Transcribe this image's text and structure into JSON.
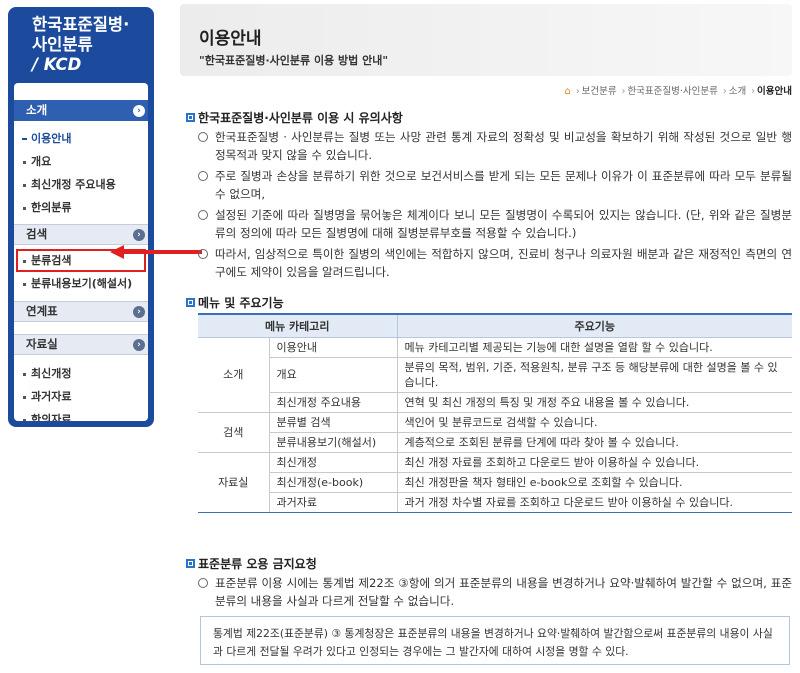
{
  "sidebar": {
    "brand_line1": "한국표준질병·",
    "brand_line2": "사인분류",
    "brand_line3": "/ KCD",
    "sections": [
      {
        "label": "소개",
        "items": [
          "이용안내",
          "개요",
          "최신개정 주요내용",
          "한의분류"
        ]
      },
      {
        "label": "검색",
        "items": [
          "분류검색",
          "분류내용보기(해설서)"
        ]
      },
      {
        "label": "연계표",
        "items": []
      },
      {
        "label": "자료실",
        "items": [
          "최신개정",
          "과거자료",
          "한의자료"
        ]
      }
    ]
  },
  "banner": {
    "title": "이용안내",
    "subtitle": "\"한국표준질병·사인분류 이용 방법 안내\""
  },
  "breadcrumb": [
    "보건분류",
    "한국표준질병·사인분류",
    "소개",
    "이용안내"
  ],
  "sections": {
    "caution_title": "한국표준질병·사인분류 이용 시 유의사항",
    "caution_items": [
      "한국표준질병 · 사인분류는 질병 또는 사망 관련 통계 자료의 정확성 및 비교성을 확보하기 위해 작성된 것으로 일반 행정목적과 맞지 않을 수 있습니다.",
      "주로 질병과 손상을 분류하기 위한 것으로 보건서비스를 받게 되는 모든 문제나 이유가 이 표준분류에 따라 모두 분류될 수 없으며,",
      "설정된 기준에 따라 질병명을 묶어놓은 체계이다 보니 모든 질병명이 수록되어 있지는 않습니다. (단, 위와 같은 질병분류의 정의에 따라 모든 질병명에 대해 질병분류부호를 적용할 수 있습니다.)",
      "따라서, 임상적으로 특이한 질병의 색인에는 적합하지 않으며, 진료비 청구나 의료자원 배분과 같은 재정적인 측면의 연구에도 제약이 있음을 알려드립니다."
    ],
    "menu_title": "메뉴 및 주요기능",
    "menu_table": {
      "headers": [
        "메뉴 카테고리",
        "주요기능"
      ],
      "groups": [
        {
          "category": "소개",
          "rows": [
            {
              "menu": "이용안내",
              "desc": "메뉴 카테고리별 제공되는 기능에 대한 설명을 열람 할 수 있습니다."
            },
            {
              "menu": "개요",
              "desc": "분류의 목적, 범위, 기준, 적용원칙, 분류 구조 등 해당분류에 대한 설명을 볼 수 있습니다."
            },
            {
              "menu": "최신개정 주요내용",
              "desc": "연혁 및 최신 개정의 특징 및 개정 주요 내용을 볼 수 있습니다."
            }
          ]
        },
        {
          "category": "검색",
          "rows": [
            {
              "menu": "분류별 검색",
              "desc": "색인어 및 분류코드로 검색할 수 있습니다."
            },
            {
              "menu": "분류내용보기(해설서)",
              "desc": "계층적으로 조회된 분류를 단계에 따라 찾아 볼 수 있습니다."
            }
          ]
        },
        {
          "category": "자료실",
          "rows": [
            {
              "menu": "최신개정",
              "desc": "최신 개정 자료를 조회하고 다운로드 받아 이용하실 수 있습니다."
            },
            {
              "menu": "최신개정(e-book)",
              "desc": "최신 개정판을 책자 형태인 e-book으로 조회할 수 있습니다."
            },
            {
              "menu": "과거자료",
              "desc": "과거 개정 차수별 자료를 조회하고 다운로드 받아 이용하실 수 있습니다."
            }
          ]
        }
      ]
    },
    "misuse_title": "표준분류 오용 금지요청",
    "misuse_item": "표준분류 이용 시에는 통계법 제22조 ③항에 의거 표준분류의 내용을 변경하거나 요약·발췌하여 발간할 수 없으며, 표준분류의 내용을 사실과 다르게 전달할 수 없습니다.",
    "law_box": "통계법 제22조(표준분류) ③ 통계청장은 표준분류의 내용을 변경하거나 요약·발췌하여 발간함으로써 표준분류의 내용이 사실과 다르게 전달될 우려가 있다고 인정되는 경우에는 그 발간자에 대하여 시정을 명할 수 있다."
  },
  "colors": {
    "brand_blue": "#1c4a9c",
    "active_blue": "#2f5fb1",
    "highlight_red": "#e02020",
    "section_icon": "#2a74c8"
  },
  "icons": [
    "home-icon",
    "chevron-right-icon",
    "red-arrow-icon"
  ]
}
